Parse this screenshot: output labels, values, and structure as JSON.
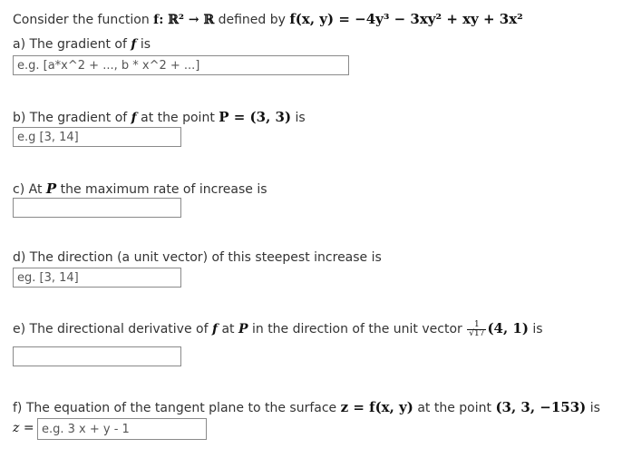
{
  "intro": {
    "consider": "Consider the function",
    "f_signature": "f: ℝ² → ℝ",
    "defined_by": "defined by",
    "f_formula": "f(x, y) = −4y³ − 3xy² + xy + 3x²"
  },
  "part_a": {
    "label": "a) The gradient of",
    "f": "f",
    "suffix": "is",
    "placeholder": "e.g. [a*x^2 + ..., b * x^2 + ...]"
  },
  "part_b": {
    "label": "b) The gradient of",
    "f": "f",
    "mid": "at the point",
    "point": "P = (3, 3)",
    "suffix": "is",
    "placeholder": "e.g [3, 14]"
  },
  "part_c": {
    "label": "c) At",
    "P": "P",
    "suffix": "the maximum rate of increase is",
    "placeholder": ""
  },
  "part_d": {
    "label": "d) The direction (a unit vector) of this steepest increase is",
    "placeholder": "eg. [3, 14]"
  },
  "part_e": {
    "label": "e) The directional derivative of",
    "f": "f",
    "at": "at",
    "P": "P",
    "mid": "in the direction of the unit vector",
    "frac_num": "1",
    "frac_den": "17",
    "vector": "(4, 1)",
    "suffix": "is",
    "placeholder": ""
  },
  "part_f": {
    "label": "f) The equation of the tangent plane to the surface",
    "surface": "z = f(x, y)",
    "mid": "at the point",
    "point": "(3, 3, −153)",
    "suffix": "is",
    "z_prefix": "z =",
    "placeholder": "e.g. 3 x + y - 1"
  }
}
